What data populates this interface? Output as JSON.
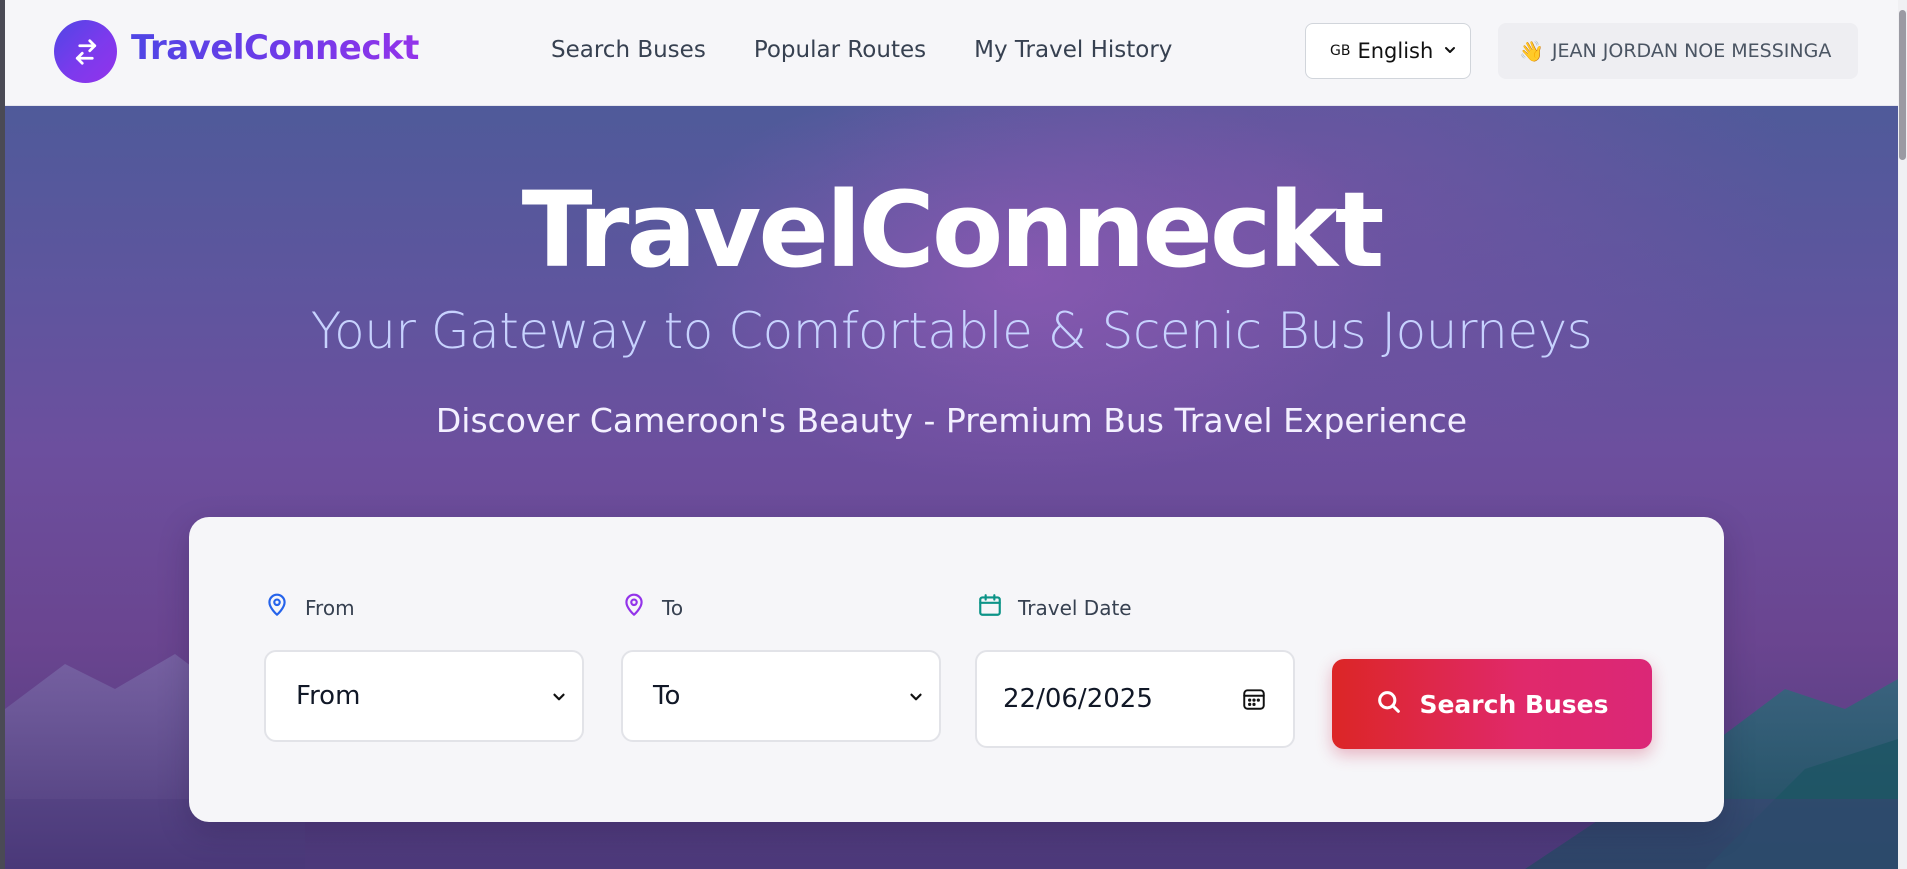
{
  "brand": {
    "name": "TravelConneckt",
    "logo_icon": "swap-arrows-icon"
  },
  "nav": {
    "links": [
      {
        "label": "Search Buses"
      },
      {
        "label": "Popular Routes"
      },
      {
        "label": "My Travel History"
      }
    ]
  },
  "language": {
    "flag": "GB",
    "selected": "English"
  },
  "user": {
    "greeting_icon": "👋",
    "name": "JEAN JORDAN NOE MESSINGA"
  },
  "hero": {
    "title": "TravelConneckt",
    "subtitle": "Your Gateway to Comfortable & Scenic Bus Journeys",
    "tagline": "Discover Cameroon's Beauty - Premium Bus Travel Experience"
  },
  "search": {
    "from_label": "From",
    "from_value": "From",
    "to_label": "To",
    "to_value": "To",
    "date_label": "Travel Date",
    "date_value": "22/06/2025",
    "button_label": "Search Buses"
  },
  "colors": {
    "brand_gradient_start": "#4f46e5",
    "brand_gradient_end": "#9333ea",
    "button_gradient_start": "#dc2626",
    "button_gradient_end": "#db2777",
    "from_icon": "#2563eb",
    "to_icon": "#9333ea",
    "date_icon": "#0d9488"
  }
}
